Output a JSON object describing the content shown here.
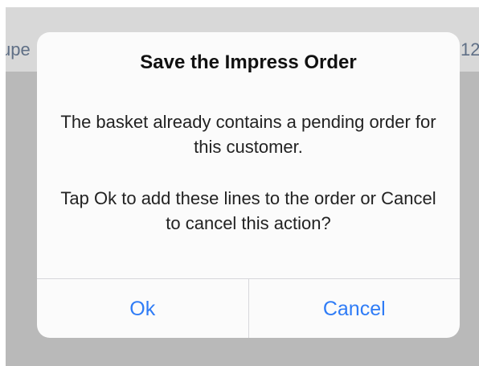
{
  "background": {
    "left_text": "upe",
    "right_text": "12"
  },
  "dialog": {
    "title": "Save the Impress Order",
    "message_line_1": "The basket already contains a pending order for this customer.",
    "message_line_2": "Tap Ok to add these lines to the order or Cancel to cancel this action?",
    "buttons": {
      "ok": "Ok",
      "cancel": "Cancel"
    }
  },
  "colors": {
    "button_text": "#2f7cf6",
    "dialog_background": "#fbfbfb",
    "backdrop": "#b9b9b9"
  }
}
